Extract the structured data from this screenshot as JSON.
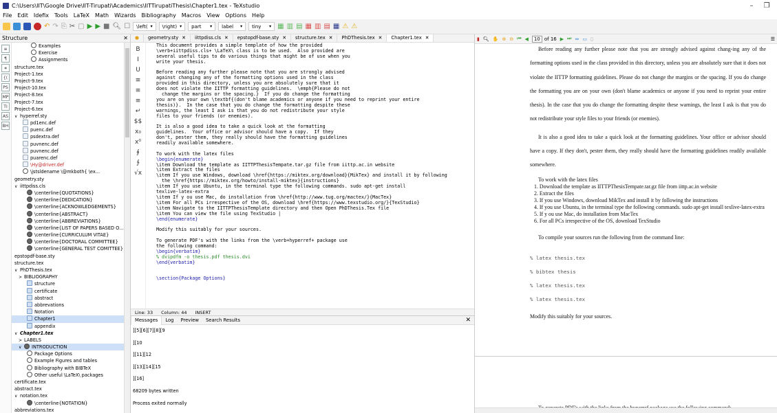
{
  "window": {
    "title": "C:\\Users\\IIT\\Google Drive\\IIT-Tirupati\\Academics\\IITTirupatiThesis\\Chapter1.tex - TeXstudio"
  },
  "menu": [
    "File",
    "Edit",
    "Idefix",
    "Tools",
    "LaTeX",
    "Math",
    "Wizards",
    "Bibliography",
    "Macros",
    "View",
    "Options",
    "Help"
  ],
  "toolbar": {
    "left_ctrl": "\\left(",
    "right_ctrl": "\\right)",
    "part": "part",
    "label": "label",
    "size": "tiny"
  },
  "colors": {
    "accent": "#2b3a8c",
    "selection": "#cde0f7"
  },
  "structure": {
    "title": "Structure",
    "side_icons": [
      "≡",
      "¶",
      "∗",
      "{(",
      "PS",
      "MP",
      "TI",
      "AS",
      "BH"
    ],
    "items": [
      {
        "label": "Examples",
        "icon": "s",
        "indent": 4
      },
      {
        "label": "Exercise",
        "icon": "s",
        "indent": 4
      },
      {
        "label": "Assignments",
        "icon": "s",
        "indent": 4
      },
      {
        "label": "structure.tex",
        "icon": "",
        "indent": 0
      },
      {
        "label": "Project-1.tex",
        "icon": "",
        "indent": 0
      },
      {
        "label": "Project-9.tex",
        "icon": "",
        "indent": 0
      },
      {
        "label": "Project-10.tex",
        "icon": "",
        "indent": 0
      },
      {
        "label": "Project-8.tex",
        "icon": "",
        "indent": 0
      },
      {
        "label": "Project-7.tex",
        "icon": "",
        "indent": 0
      },
      {
        "label": "Project-6.tex",
        "icon": "",
        "indent": 0
      },
      {
        "label": "hyperref.sty",
        "icon": "",
        "indent": 0,
        "arr": "∨"
      },
      {
        "label": "pd1enc.def",
        "icon": "f",
        "indent": 2
      },
      {
        "label": "puenc.def",
        "icon": "f",
        "indent": 2
      },
      {
        "label": "psdextra.def",
        "icon": "f",
        "indent": 2
      },
      {
        "label": "puvnenc.def",
        "icon": "f",
        "indent": 2
      },
      {
        "label": "puvnenc.def",
        "icon": "f",
        "indent": 2
      },
      {
        "label": "puarenc.def",
        "icon": "f",
        "indent": 2
      },
      {
        "label": "\\Hy@driver.def",
        "icon": "f",
        "indent": 2,
        "red": true
      },
      {
        "label": "\\jstsldename    \\@mkboth{    \\ex...",
        "icon": "s",
        "indent": 2
      },
      {
        "label": "geometry.sty",
        "icon": "",
        "indent": 0
      },
      {
        "label": "iittpdiss.cls",
        "icon": "",
        "indent": 0,
        "arr": "∨"
      },
      {
        "label": "\\centerline{QUOTATIONS}",
        "icon": "c",
        "indent": 3
      },
      {
        "label": "\\centerline{DEDICATION}",
        "icon": "c",
        "indent": 3
      },
      {
        "label": "\\centerline{ACKNOWLEDGEMENTS}",
        "icon": "c",
        "indent": 3
      },
      {
        "label": "\\centerline{ABSTRACT}",
        "icon": "c",
        "indent": 3
      },
      {
        "label": "\\centerline{ABBREVIATIONS}",
        "icon": "c",
        "indent": 3
      },
      {
        "label": "\\centerline{LIST OF PAPERS BASED O...",
        "icon": "c",
        "indent": 3
      },
      {
        "label": "\\centerline{CURRICULUM VITAE}",
        "icon": "c",
        "indent": 3
      },
      {
        "label": "\\centerline{DOCTORAL COMMITTEE}",
        "icon": "c",
        "indent": 3
      },
      {
        "label": "\\centerline{GENERAL TEST COMITTEE}",
        "icon": "c",
        "indent": 3
      },
      {
        "label": "epstopdf-base.sty",
        "icon": "",
        "indent": 0
      },
      {
        "label": "structure.tex",
        "icon": "",
        "indent": 0
      },
      {
        "label": "PhDThesis.tex",
        "icon": "",
        "indent": 0,
        "arr": "∨"
      },
      {
        "label": "BIBLIOGRAPHY",
        "icon": "",
        "indent": 1,
        "arr": ">"
      },
      {
        "label": "structure",
        "icon": "folder",
        "indent": 3
      },
      {
        "label": "certificate",
        "icon": "folder",
        "indent": 3
      },
      {
        "label": "abstract",
        "icon": "folder",
        "indent": 3
      },
      {
        "label": "abbrevations",
        "icon": "folder",
        "indent": 3
      },
      {
        "label": "Notation",
        "icon": "folder",
        "indent": 3
      },
      {
        "label": "Chapter1",
        "icon": "folder",
        "indent": 3,
        "sel2": true
      },
      {
        "label": "appendix",
        "icon": "folder",
        "indent": 3
      },
      {
        "label": "Chapter1.tex",
        "icon": "",
        "indent": 0,
        "arr": "∨",
        "bold": true
      },
      {
        "label": "LABELS",
        "icon": "",
        "indent": 1,
        "arr": ">"
      },
      {
        "label": "INTRODUCTION",
        "icon": "c",
        "indent": 1,
        "arr": "∨",
        "sel": true
      },
      {
        "label": "Package Options",
        "icon": "s",
        "indent": 3
      },
      {
        "label": "Example Figures and tables",
        "icon": "s",
        "indent": 3
      },
      {
        "label": "Bibliography with BIBTeX",
        "icon": "s",
        "indent": 3
      },
      {
        "label": "Other useful \\LaTeX\\ packages",
        "icon": "s",
        "indent": 3
      },
      {
        "label": "certificate.tex",
        "icon": "",
        "indent": 0
      },
      {
        "label": "abstract.tex",
        "icon": "",
        "indent": 0
      },
      {
        "label": "notation.tex",
        "icon": "",
        "indent": 0,
        "arr": "∨"
      },
      {
        "label": "\\centerline{NOTATION}",
        "icon": "c",
        "indent": 3
      },
      {
        "label": "abbreviations.tex",
        "icon": "",
        "indent": 0
      }
    ]
  },
  "editor": {
    "tabs": [
      "geometry.sty",
      "iittpdiss.cls",
      "epstopdf-base.sty",
      "structure.tex",
      "PhDThesis.tex",
      "Chapter1.tex"
    ],
    "active_tab": 5,
    "icons": [
      "B",
      "I",
      "U",
      "≡",
      "≡",
      "≡",
      "↵",
      "$$",
      "x₀",
      "x⁰",
      "∮",
      "∱",
      "√x"
    ],
    "lines": [
      {
        "t": "This document provides a simple template of how the provided",
        "c": ""
      },
      {
        "t": "\\verb+iittpdiss.cls+ \\LaTeX\\ class is to be used.  Also provided are",
        "c": ""
      },
      {
        "t": "several useful tips to do various things that might be of use when you",
        "c": ""
      },
      {
        "t": "write your thesis.",
        "c": ""
      },
      {
        "t": "",
        "c": ""
      },
      {
        "t": "Before reading any further please note that you are strongly advised",
        "c": ""
      },
      {
        "t": "against changing any of the formatting options used in the class",
        "c": ""
      },
      {
        "t": "provided in this directory, unless you are absolutely sure that it",
        "c": ""
      },
      {
        "t": "does not violate the IITTP formatting guidelines.  \\emph{Please do not",
        "c": ""
      },
      {
        "t": "  change the margins or the spacing.}  If you do change the formatting",
        "c": ""
      },
      {
        "t": "you are on your own \\textbf{(don't blame academics or anyone if you need to reprint your entire",
        "c": ""
      },
      {
        "t": "thesis)}.  In the case that you do change the formatting despite these",
        "c": ""
      },
      {
        "t": "warnings, the least I ask is that you do not redistribute your style",
        "c": ""
      },
      {
        "t": "files to your friends (or enemies).",
        "c": ""
      },
      {
        "t": "",
        "c": ""
      },
      {
        "t": "It is also a good idea to take a quick look at the formatting",
        "c": ""
      },
      {
        "t": "guidelines.  Your office or advisor should have a copy.  If they",
        "c": ""
      },
      {
        "t": "don't, pester them, they really should have the formatting guidelines",
        "c": ""
      },
      {
        "t": "readily available somewhere.",
        "c": ""
      },
      {
        "t": "",
        "c": ""
      },
      {
        "t": "To work with the latex files",
        "c": ""
      },
      {
        "t": "\\begin{enumerate}",
        "c": "blue"
      },
      {
        "t": "\\item Download the template as IITTPThesisTempate.tar.gz file from iittp.ac.in website",
        "c": ""
      },
      {
        "t": "\\item Extract the files",
        "c": ""
      },
      {
        "t": "\\item If you use Windows, download \\href{https://miktex.org/download}{MikTex} and install it by following",
        "c": ""
      },
      {
        "t": "  the \\href{https://miktex.org/howto/install-miktex}{instructions}",
        "c": ""
      },
      {
        "t": "\\item If you use Ubuntu, in the terminal type the following commands. sudo apt-get install",
        "c": ""
      },
      {
        "t": "texlive-latex-extra",
        "c": ""
      },
      {
        "t": "\\item If y ou use Mac, do installation from \\href{http://www.tug.org/mactex/}{MacTex}",
        "c": ""
      },
      {
        "t": "\\item For all PCs irrespective of the OS, download \\href{https://www.texstudio.org/}{TexStudio}",
        "c": ""
      },
      {
        "t": "\\item Navigate to the IITTPThesisTemplate directory and then Open PhDThesis.Tex file",
        "c": ""
      },
      {
        "t": "\\item You can view the file using TexStudio |",
        "c": ""
      },
      {
        "t": "\\end{enumerate}",
        "c": "blue"
      },
      {
        "t": "",
        "c": ""
      },
      {
        "t": "Modify this suitably for your sources.",
        "c": ""
      },
      {
        "t": "",
        "c": ""
      },
      {
        "t": "To generate PDF's with the links from the \\verb+hyperref+ package use",
        "c": ""
      },
      {
        "t": "the following command:",
        "c": ""
      },
      {
        "t": "\\begin{verbatim}",
        "c": "blue"
      },
      {
        "t": "% dvipdfm -o thesis.pdf thesis.dvi",
        "c": "grn"
      },
      {
        "t": "\\end{verbatim}",
        "c": "blue"
      },
      {
        "t": "",
        "c": ""
      },
      {
        "t": "",
        "c": ""
      },
      {
        "t": "\\section{Package Options}",
        "c": "blue"
      }
    ],
    "status": {
      "line": "Line: 33",
      "column": "Column: 44",
      "mode": "INSERT"
    }
  },
  "messages": {
    "tabs": [
      "Messages",
      "Log",
      "Preview",
      "Search Results"
    ],
    "lines": [
      "][5][6][7][8][9",
      "][10",
      "][11][12",
      "][13][14][15",
      "][16]",
      "68209 bytes written",
      "Process exited normally"
    ]
  },
  "preview": {
    "page": "10",
    "of": "of 16",
    "para1": "Before reading any further please note that you are strongly advised against chang-ing any of the formatting options used in the class provided in this directory, unless you are absolutely sure that it does not violate the IITTP formatting guidelines. Please do not change the margins or the spacing. If you do change the formatting you are on your own (don't blame academics or anyone if you need to reprint your entire thesis). In the case that you do change the formatting despite these warnings, the least I ask is that you do not redistribute your style files to your friends (or enemies).",
    "para2": "It is also a good idea to take a quick look at the formatting guidelines. Your office or advisor should have a copy. If they don't, pester them, they really should have the formatting guidelines readily available somewhere.",
    "list_intro": "To work with the latex files",
    "list": [
      "Download the template as IITTPThesisTempate.tar.gz file from iittp.ac.in website",
      "Extract the files",
      "If you use Windows, download MikTex and install it by following the instructions",
      "If you use Ubuntu, in the terminal type the following commands. sudo apt-get install texlive-latex-extra",
      "If y ou use Mac, do installation from MacTex",
      "For all PCs irrespective of the OS, download TexStudio"
    ],
    "compile": "To compile your sources run the following from the command line:",
    "cmds": [
      "% latex thesis.tex",
      "% bibtex thesis",
      "% latex thesis.tex",
      "% latex thesis.tex"
    ],
    "modify": "Modify this suitably for your sources.",
    "generate": "To generate PDF's with the links from the hyperref package use the following command:"
  }
}
